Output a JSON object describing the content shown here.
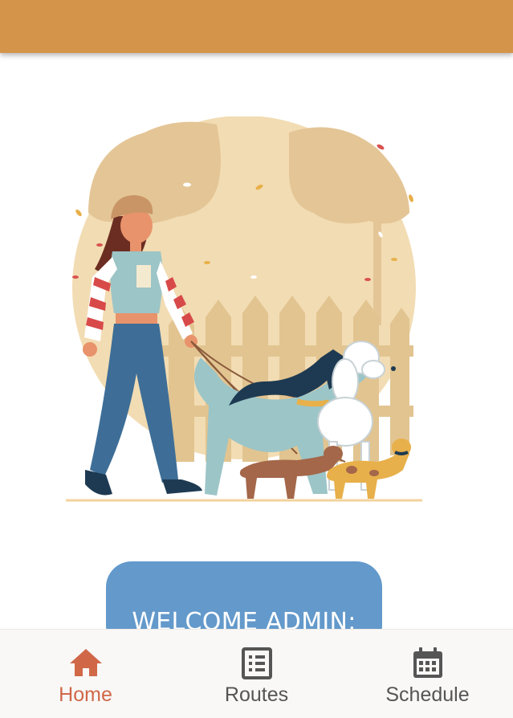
{
  "app_bar": {
    "color": "#d4954b"
  },
  "hero": {
    "illustration": "woman-walking-dogs"
  },
  "main": {
    "welcome_label": "WELCOME ADMIN:"
  },
  "bottom_nav": {
    "items": [
      {
        "label": "Home",
        "icon": "home-icon",
        "active": true
      },
      {
        "label": "Routes",
        "icon": "list-icon",
        "active": false
      },
      {
        "label": "Schedule",
        "icon": "calendar-icon",
        "active": false
      }
    ],
    "active_color": "#d06848",
    "inactive_color": "#555555"
  }
}
